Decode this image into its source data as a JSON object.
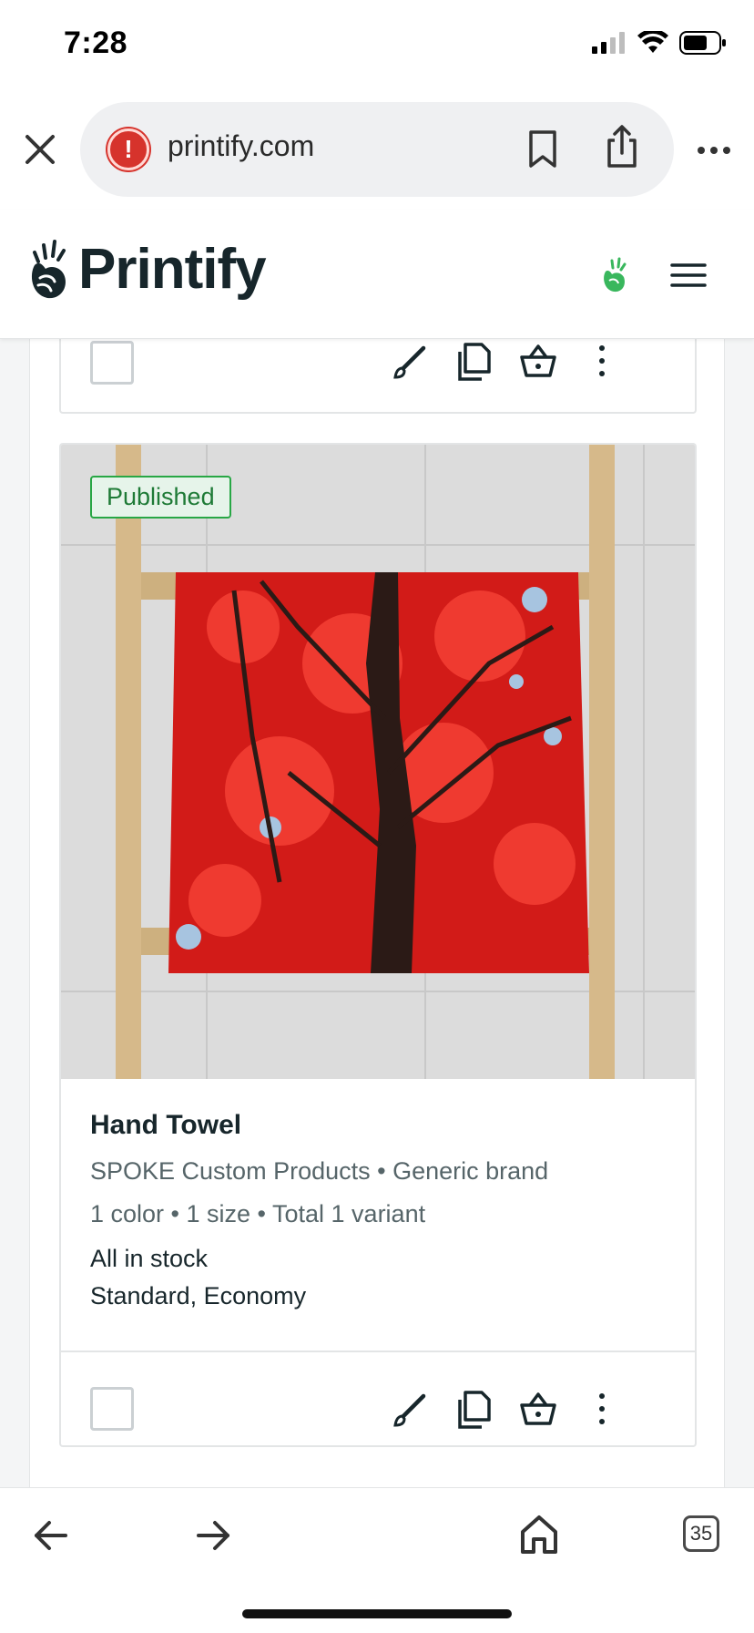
{
  "status": {
    "time": "7:28"
  },
  "browser": {
    "url": "printify.com"
  },
  "header": {
    "brand": "Printify"
  },
  "product": {
    "badge": "Published",
    "title": "Hand Towel",
    "provider": "SPOKE Custom Products • Generic brand",
    "variants": "1 color • 1 size • Total 1 variant",
    "stock": "All in stock",
    "shipping": "Standard, Economy"
  },
  "toolbar": {
    "tab_count": "35"
  },
  "colors": {
    "brand_dark": "#17262b",
    "published_green": "#28a745",
    "warning_red": "#d6332c",
    "accent_green": "#39b75d"
  },
  "icons": [
    "close-icon",
    "warning-icon",
    "bookmark-icon",
    "share-icon",
    "more-icon",
    "printify-logo-icon",
    "hamburger-icon",
    "edit-icon",
    "copy-icon",
    "basket-icon",
    "kebab-icon",
    "back-icon",
    "forward-icon",
    "home-icon"
  ]
}
